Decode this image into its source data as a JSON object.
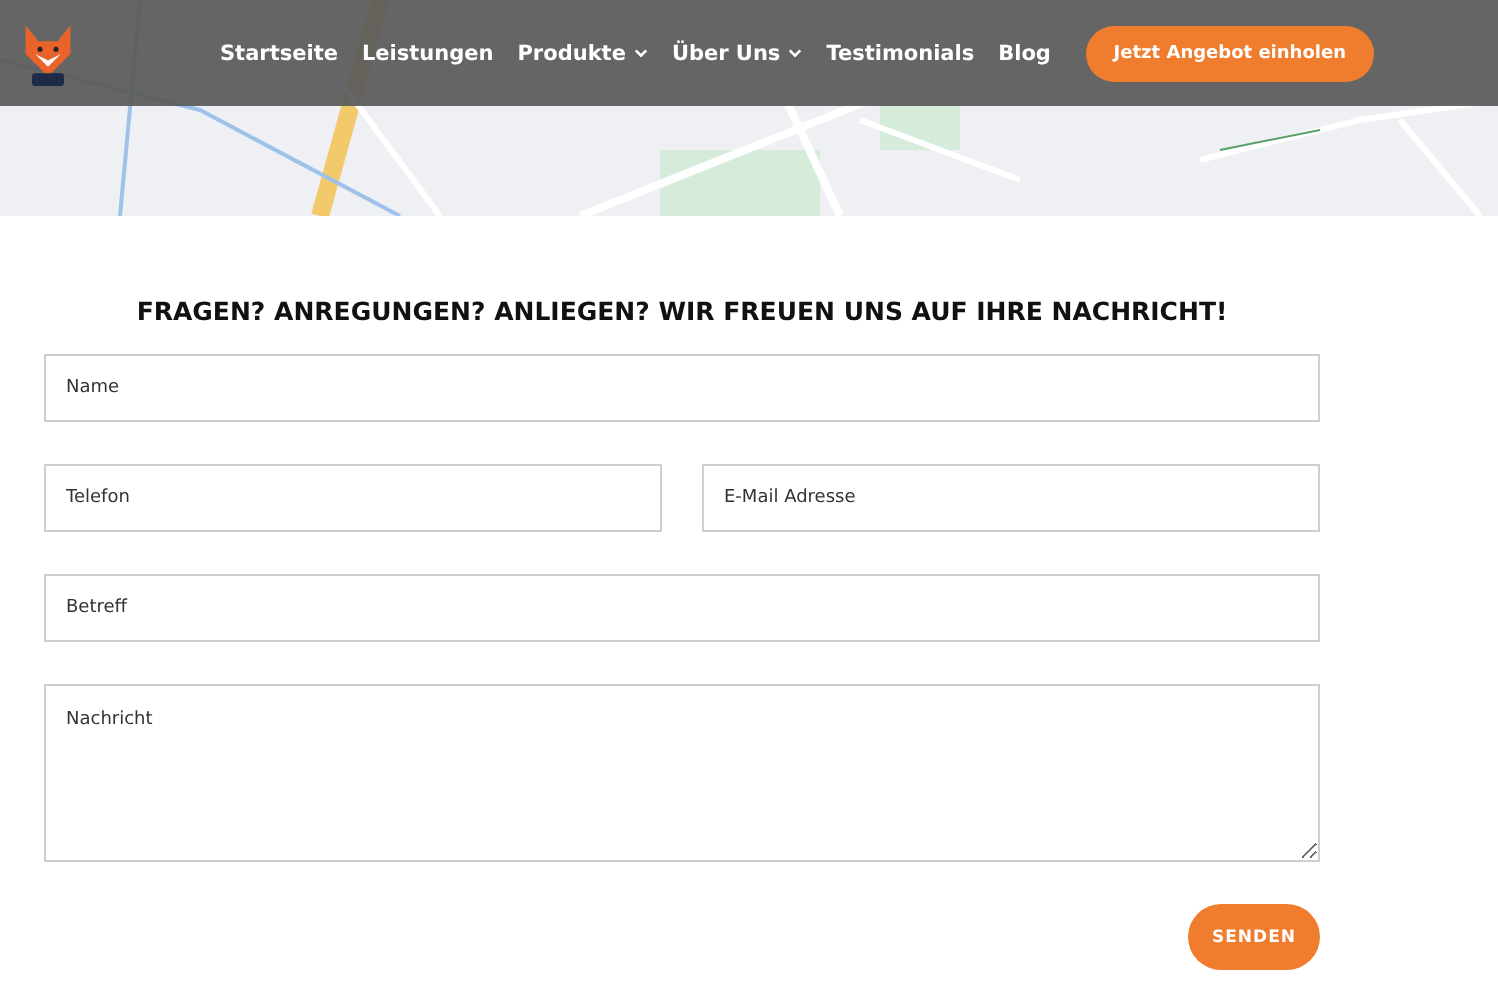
{
  "nav": {
    "items": [
      {
        "label": "Startseite",
        "dropdown": false
      },
      {
        "label": "Leistungen",
        "dropdown": false
      },
      {
        "label": "Produkte",
        "dropdown": true
      },
      {
        "label": "Über Uns",
        "dropdown": true
      },
      {
        "label": "Testimonials",
        "dropdown": false
      },
      {
        "label": "Blog",
        "dropdown": false
      }
    ],
    "cta": "Jetzt Angebot einholen"
  },
  "form": {
    "heading": "FRAGEN? ANREGUNGEN? ANLIEGEN? WIR FREUEN UNS AUF IHRE NACHRICHT!",
    "rows": [
      [
        {
          "kind": "input",
          "placeholder": "Name"
        }
      ],
      [
        {
          "kind": "input",
          "placeholder": "Telefon"
        },
        {
          "kind": "input",
          "placeholder": "E-Mail Adresse"
        }
      ],
      [
        {
          "kind": "input",
          "placeholder": "Betreff"
        }
      ],
      [
        {
          "kind": "textarea",
          "placeholder": "Nachricht"
        }
      ]
    ],
    "submit": "SENDEN"
  }
}
